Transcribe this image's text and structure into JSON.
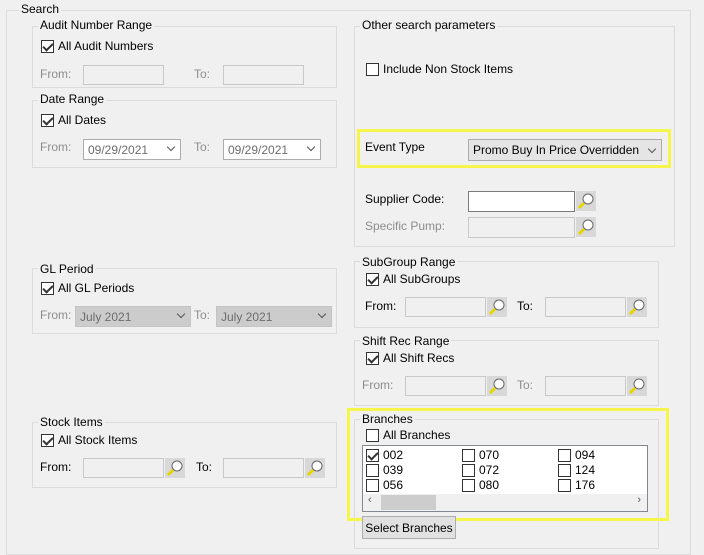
{
  "search": {
    "title": "Search"
  },
  "audit": {
    "title": "Audit Number Range",
    "all_label": "All Audit Numbers",
    "all_checked": true,
    "from_label": "From:",
    "to_label": "To:"
  },
  "date": {
    "title": "Date Range",
    "all_label": "All Dates",
    "all_checked": true,
    "from_label": "From:",
    "from_value": "09/29/2021",
    "to_label": "To:",
    "to_value": "09/29/2021"
  },
  "gl": {
    "title": "GL Period",
    "all_label": "All GL Periods",
    "all_checked": true,
    "from_label": "From:",
    "from_value": "July 2021",
    "to_label": "To:",
    "to_value": "July 2021"
  },
  "stock": {
    "title": "Stock Items",
    "all_label": "All Stock Items",
    "all_checked": true,
    "from_label": "From:",
    "to_label": "To:"
  },
  "other": {
    "title": "Other search parameters",
    "non_stock_label": "Include Non Stock Items",
    "non_stock_checked": false,
    "event_type_label": "Event Type",
    "event_type_value": "Promo Buy In Price Overridden",
    "supplier_label": "Supplier Code:",
    "supplier_value": "",
    "pump_label": "Specific Pump:"
  },
  "subgroup": {
    "title": "SubGroup Range",
    "all_label": "All SubGroups",
    "all_checked": true,
    "from_label": "From:",
    "to_label": "To:"
  },
  "shift": {
    "title": "Shift Rec Range",
    "all_label": "All Shift Recs",
    "all_checked": true,
    "from_label": "From:",
    "to_label": "To:"
  },
  "branches": {
    "title": "Branches",
    "all_label": "All Branches",
    "all_checked": false,
    "items": [
      {
        "code": "002",
        "checked": true
      },
      {
        "code": "070",
        "checked": false
      },
      {
        "code": "094",
        "checked": false
      },
      {
        "code": "039",
        "checked": false
      },
      {
        "code": "072",
        "checked": false
      },
      {
        "code": "124",
        "checked": false
      },
      {
        "code": "056",
        "checked": false
      },
      {
        "code": "080",
        "checked": false
      },
      {
        "code": "176",
        "checked": false
      }
    ],
    "select_button": "Select Branches"
  },
  "highlight_color": "#f6f64a"
}
